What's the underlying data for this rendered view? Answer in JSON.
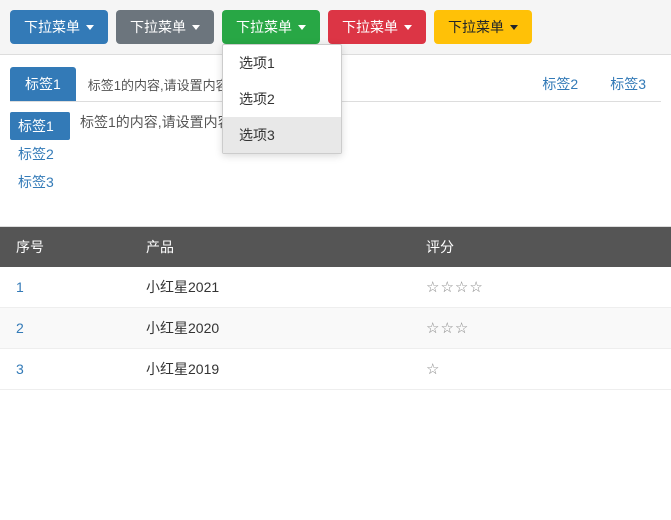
{
  "toolbar": {
    "buttons": [
      {
        "id": "btn1",
        "label": "下拉菜单",
        "style": "btn-blue"
      },
      {
        "id": "btn2",
        "label": "下拉菜单",
        "style": "btn-gray"
      },
      {
        "id": "btn3",
        "label": "下拉菜单",
        "style": "btn-green",
        "open": true
      },
      {
        "id": "btn4",
        "label": "下拉菜单",
        "style": "btn-red"
      },
      {
        "id": "btn5",
        "label": "下拉菜单",
        "style": "btn-yellow"
      }
    ]
  },
  "dropdown": {
    "items": [
      {
        "id": "opt1",
        "label": "选项1"
      },
      {
        "id": "opt2",
        "label": "选项2"
      },
      {
        "id": "opt3",
        "label": "选项3",
        "selected": true
      }
    ]
  },
  "tabs_horizontal": {
    "tabs": [
      {
        "id": "tab1",
        "label": "标签1",
        "active": true
      },
      {
        "id": "tab2",
        "label": "标签2"
      },
      {
        "id": "tab3",
        "label": "标签3"
      }
    ],
    "content": "标签1的内容,请设置内容页面"
  },
  "tabs_vertical": {
    "tabs": [
      {
        "id": "vtab1",
        "label": "标签1",
        "active": true
      },
      {
        "id": "vtab2",
        "label": "标签2"
      },
      {
        "id": "vtab3",
        "label": "标签3"
      }
    ],
    "content": "标签1的内容,请设置内容页面"
  },
  "table": {
    "columns": [
      {
        "id": "col-seq",
        "label": "序号"
      },
      {
        "id": "col-product",
        "label": "产品"
      },
      {
        "id": "col-rating",
        "label": "评分"
      }
    ],
    "rows": [
      {
        "seq": "1",
        "product": "小红星2021",
        "stars": "☆☆☆☆"
      },
      {
        "seq": "2",
        "product": "小红星2020",
        "stars": "☆☆☆"
      },
      {
        "seq": "3",
        "product": "小红星2019",
        "stars": "☆"
      }
    ]
  }
}
